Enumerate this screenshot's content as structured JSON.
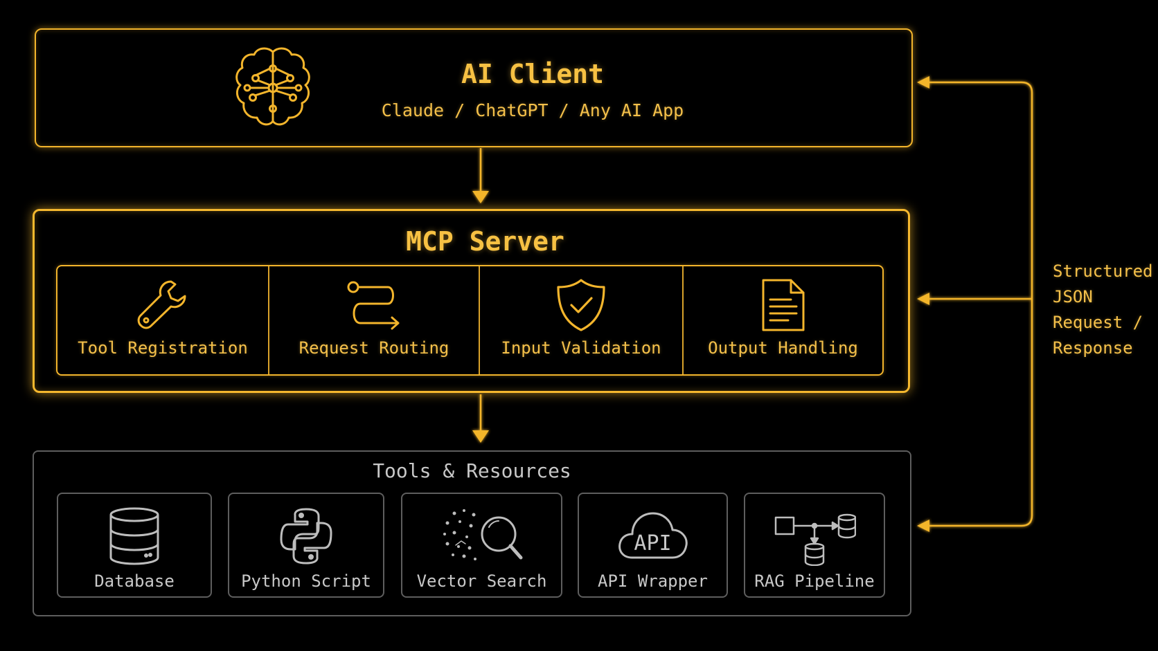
{
  "ai_client": {
    "title": "AI Client",
    "subtitle": "Claude / ChatGPT / Any AI App",
    "icon": "brain-circuit-icon"
  },
  "mcp_server": {
    "title": "MCP Server",
    "components": [
      {
        "label": "Tool Registration",
        "icon": "wrench-icon"
      },
      {
        "label": "Request Routing",
        "icon": "route-icon"
      },
      {
        "label": "Input Validation",
        "icon": "shield-check-icon"
      },
      {
        "label": "Output Handling",
        "icon": "document-icon"
      }
    ]
  },
  "tools_resources": {
    "title": "Tools & Resources",
    "items": [
      {
        "label": "Database",
        "icon": "database-icon"
      },
      {
        "label": "Python Script",
        "icon": "python-icon"
      },
      {
        "label": "Vector Search",
        "icon": "vector-search-icon"
      },
      {
        "label": "API Wrapper",
        "icon": "api-cloud-icon",
        "icon_text": "API"
      },
      {
        "label": "RAG Pipeline",
        "icon": "pipeline-icon"
      }
    ]
  },
  "side_note": {
    "lines": [
      "Structured",
      "JSON",
      "Request /",
      "Response"
    ]
  },
  "colors": {
    "accent": "#f3b52c",
    "muted_border": "#5e5e5e",
    "muted_text": "#c8c8c8",
    "background": "#000000"
  }
}
